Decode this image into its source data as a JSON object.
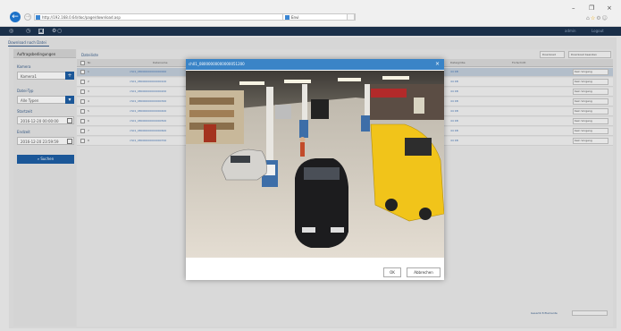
{
  "browser": {
    "url": "http://192.168.0.64/doc/page/download.asp",
    "search_hint": "ρ ▾ c",
    "tab_title": "Envi",
    "tab_close": "×",
    "window_controls": [
      "–",
      "❐",
      "×"
    ],
    "icons": [
      "home-icon",
      "star-icon",
      "gear-icon",
      "smiley-icon"
    ]
  },
  "app": {
    "header_right": [
      "admin",
      "Logout"
    ],
    "subtitle": "Download nach Datei"
  },
  "left_panel": {
    "header": "Auftragsbedingungen",
    "fields": [
      {
        "label": "Kamera",
        "value": "Kamera1"
      },
      {
        "label": "Datei-Typ",
        "value": "Alle Typen"
      },
      {
        "label": "Startzeit",
        "value": "2016-12-20 00:00:00"
      },
      {
        "label": "Endzeit",
        "value": "2016-12-20 23:59:59"
      }
    ],
    "search_button": "Suchen"
  },
  "right_panel": {
    "title": "Dateiliste",
    "columns": [
      "Nr.",
      "Dateiname",
      "Dateigröße",
      "Fortschritt",
      ""
    ],
    "buttons": [
      "Download",
      "Download beenden"
    ],
    "rows": [
      {
        "num": "1",
        "name": "ch01_08000000000000000",
        "size": "44 KB",
        "status": "Kein Vorgang"
      },
      {
        "num": "2",
        "name": "ch01_08000000000000100",
        "size": "44 KB",
        "status": "Kein Vorgang"
      },
      {
        "num": "3",
        "name": "ch01_08000000000000200",
        "size": "44 KB",
        "status": "Kein Vorgang"
      },
      {
        "num": "4",
        "name": "ch01_08000000000000300",
        "size": "44 KB",
        "status": "Kein Vorgang"
      },
      {
        "num": "5",
        "name": "ch01_08000000000000400",
        "size": "44 KB",
        "status": "Kein Vorgang"
      },
      {
        "num": "6",
        "name": "ch01_08000000000000500",
        "size": "44 KB",
        "status": "Kein Vorgang"
      },
      {
        "num": "7",
        "name": "ch01_08000000000000600",
        "size": "44 KB",
        "status": "Kein Vorgang"
      },
      {
        "num": "8",
        "name": "ch01_08000000000000700",
        "size": "44 KB",
        "status": "Kein Vorgang"
      }
    ],
    "pager": "Gesamt 8 Elemente"
  },
  "modal": {
    "title": "ch01_08000000000000051200",
    "close": "×",
    "ok": "OK",
    "cancel": "Abbrechen"
  },
  "colors": {
    "header_bg": "#1d3350",
    "modal_header": "#3a84c7",
    "accent": "#1e5fa5",
    "link": "#4a7ab8"
  }
}
